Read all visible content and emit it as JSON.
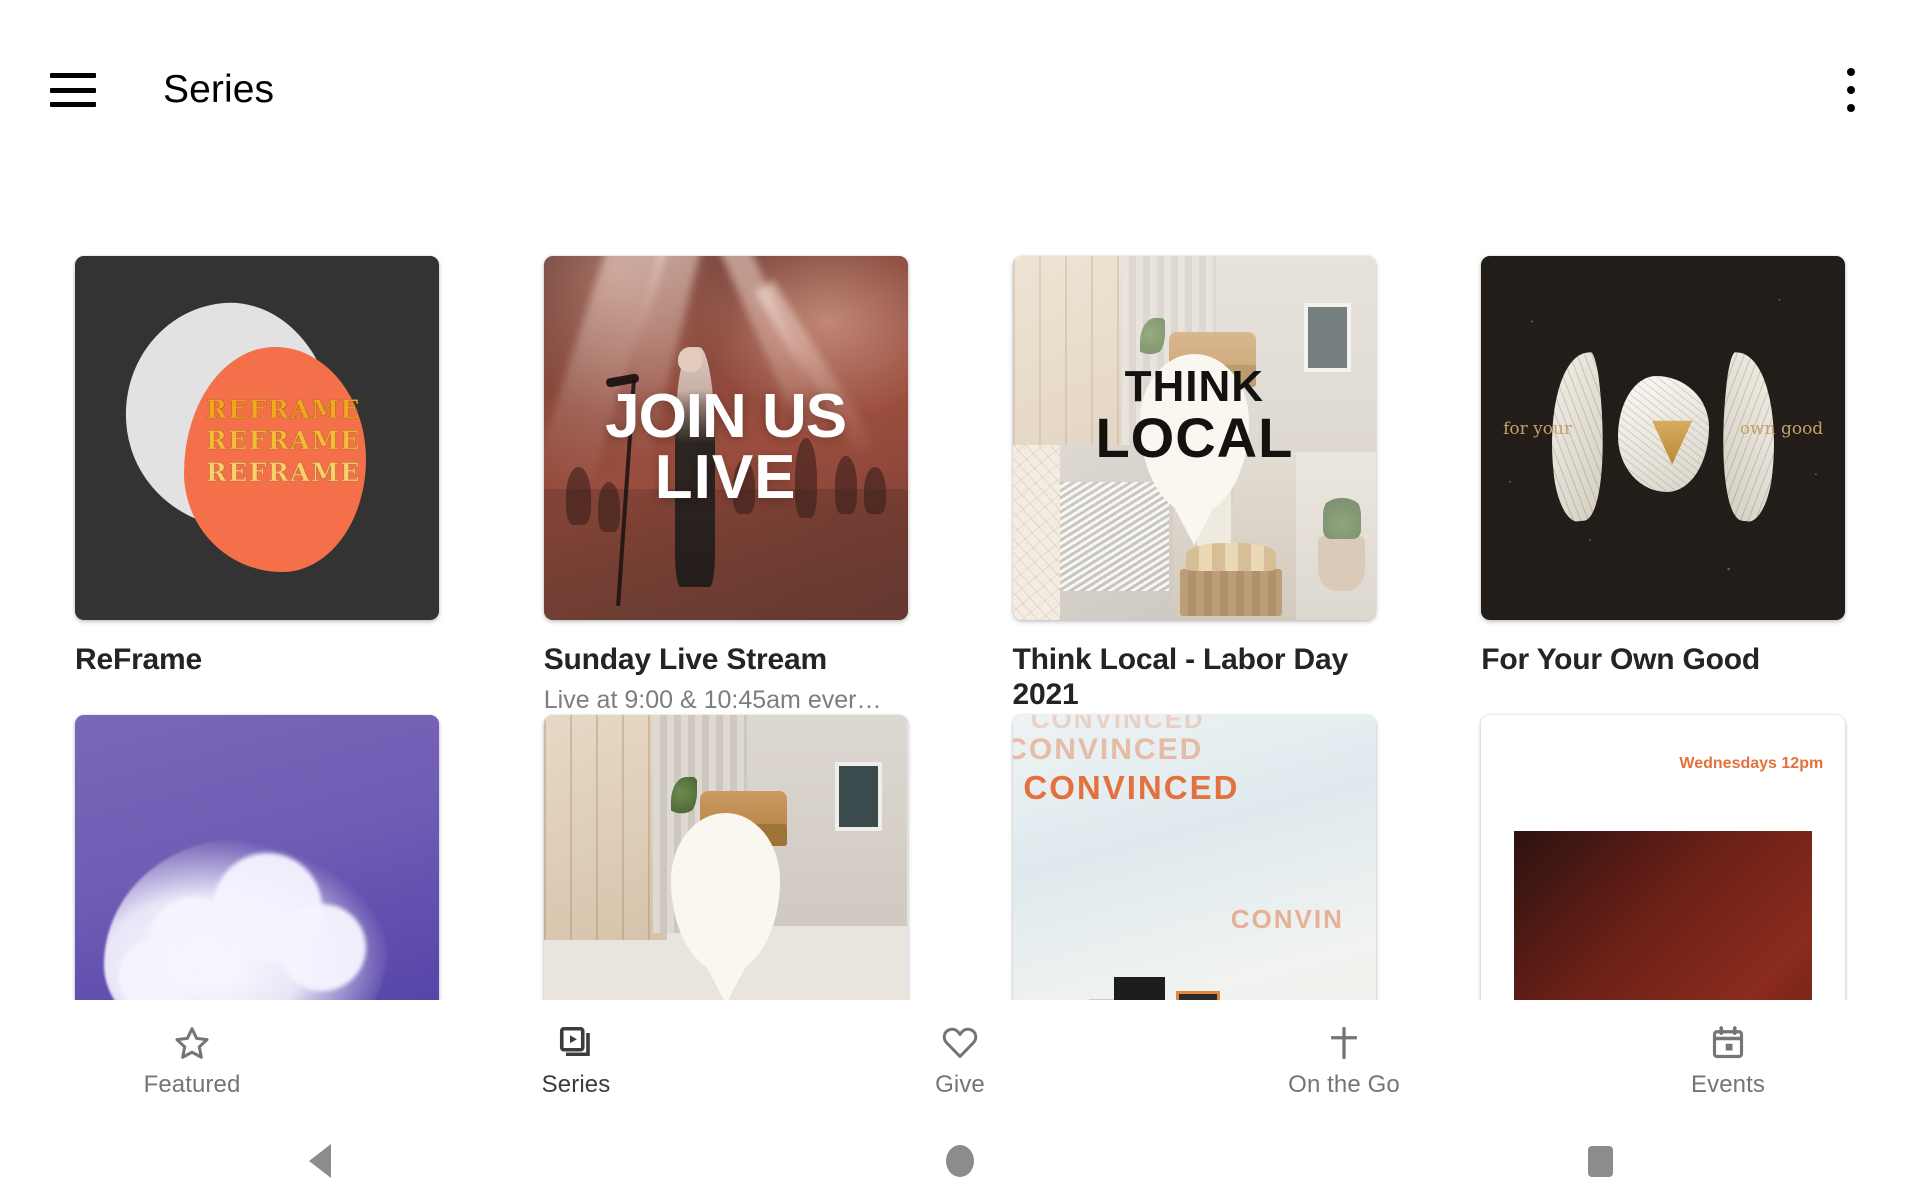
{
  "appbar": {
    "title": "Series",
    "menu_icon": "hamburger-menu-icon",
    "overflow_icon": "more-vertical-icon"
  },
  "series": [
    {
      "title": "ReFrame",
      "subtitle": "",
      "artwork": "reframe-artwork",
      "artwork_text": [
        "REFRAME",
        "REFRAME",
        "REFRAME"
      ],
      "colors": {
        "bg": "#333333",
        "blob": "#f4704a",
        "accent": "#f0a81e"
      }
    },
    {
      "title": "Sunday Live Stream",
      "subtitle": "Live at 9:00 & 10:45am ever…",
      "artwork": "join-us-live-artwork",
      "artwork_text": [
        "JOIN US",
        "LIVE"
      ],
      "colors": {
        "bg": "#8e4a3c",
        "text": "#ffffff"
      }
    },
    {
      "title": "Think Local - Labor Day 2021",
      "subtitle": "",
      "artwork": "think-local-artwork",
      "artwork_text": [
        "THINK",
        "LOCAL"
      ],
      "colors": {
        "bg": "#e9e4dd",
        "text": "#14120f"
      }
    },
    {
      "title": "For Your Own Good",
      "subtitle": "",
      "artwork": "for-your-own-good-artwork",
      "artwork_text": [
        "for your",
        "own good"
      ],
      "colors": {
        "bg": "#221d18",
        "text": "#c3a06a"
      }
    }
  ],
  "series_row2": [
    {
      "title": "",
      "artwork": "cloud-artwork",
      "artwork_text": []
    },
    {
      "title": "",
      "artwork": "think-local-alt-artwork",
      "artwork_text": []
    },
    {
      "title": "",
      "artwork": "convinced-artwork",
      "artwork_text": [
        "CONVINCED",
        "CONVINCED",
        "CONVINCED",
        "CONVIN"
      ]
    },
    {
      "title": "",
      "artwork": "wednesdays-artwork",
      "artwork_text": [
        "Wednesdays 12pm"
      ]
    }
  ],
  "tabs": [
    {
      "label": "Featured",
      "icon": "star-icon",
      "active": false
    },
    {
      "label": "Series",
      "icon": "series-icon",
      "active": true
    },
    {
      "label": "Give",
      "icon": "heart-icon",
      "active": false
    },
    {
      "label": "On the Go",
      "icon": "cross-icon",
      "active": false
    },
    {
      "label": "Events",
      "icon": "calendar-icon",
      "active": false
    }
  ],
  "android_nav": [
    {
      "name": "back-button"
    },
    {
      "name": "home-button"
    },
    {
      "name": "recents-button"
    }
  ]
}
